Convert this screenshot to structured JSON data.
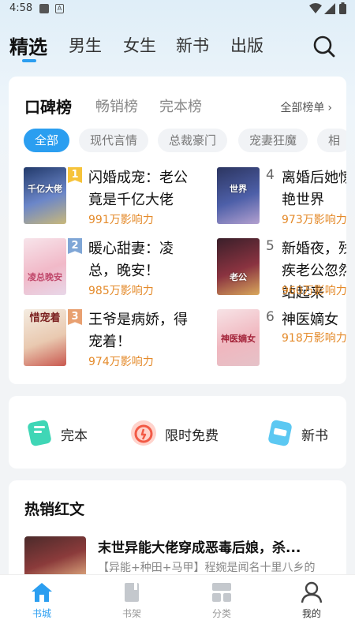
{
  "status_bar": {
    "time": "4:58",
    "icon_b": "A"
  },
  "top_nav": {
    "tabs": [
      {
        "label": "精选"
      },
      {
        "label": "男生"
      },
      {
        "label": "女生"
      },
      {
        "label": "新书"
      },
      {
        "label": "出版"
      }
    ],
    "active_index": 0,
    "search_icon": "search-icon"
  },
  "ranking": {
    "tabs": [
      {
        "label": "口碑榜"
      },
      {
        "label": "畅销榜"
      },
      {
        "label": "完本榜"
      }
    ],
    "all_label": "全部榜单",
    "chips": [
      {
        "label": "全部"
      },
      {
        "label": "现代言情"
      },
      {
        "label": "总裁豪门"
      },
      {
        "label": "宠妻狂魔"
      },
      {
        "label": "相"
      }
    ],
    "books": [
      {
        "rank": "1",
        "title": "闪婚成宠：老公竟是千亿大佬",
        "heat": "991万影响力"
      },
      {
        "rank": "2",
        "title": "暖心甜妻：凌总，晚安！",
        "heat": "985万影响力"
      },
      {
        "rank": "3",
        "title": "王爷是病娇，得宠着！",
        "heat": "974万影响力"
      },
      {
        "rank": "4",
        "title": "离婚后她惊艳世界",
        "heat": "973万影响力"
      },
      {
        "rank": "5",
        "title": "新婚夜，残疾老公忽然站起来",
        "heat": "960万影响力"
      },
      {
        "rank": "6",
        "title": "神医嫡女",
        "heat": "918万影响力"
      }
    ],
    "cover_texts": [
      "千亿大佬",
      "凌总晚安",
      "惜宠着",
      "世界",
      "老公",
      "神医嫡女"
    ]
  },
  "entries": [
    {
      "label": "完本",
      "icon": "finished-book-icon"
    },
    {
      "label": "限时免费",
      "icon": "timer-icon"
    },
    {
      "label": "新书",
      "icon": "new-book-icon"
    }
  ],
  "hot": {
    "title": "热销红文",
    "book_title": "末世异能大佬穿成恶毒后娘，杀...",
    "book_desc": "【异能+种田+马甲】程婉是闻名十里八乡的"
  },
  "bottom_nav": [
    {
      "label": "书城",
      "icon": "home-icon"
    },
    {
      "label": "书架",
      "icon": "bookshelf-icon"
    },
    {
      "label": "分类",
      "icon": "category-icon"
    },
    {
      "label": "我的",
      "icon": "profile-icon"
    }
  ],
  "colors": {
    "accent": "#2b9ef0",
    "heat": "#e48a2a"
  }
}
